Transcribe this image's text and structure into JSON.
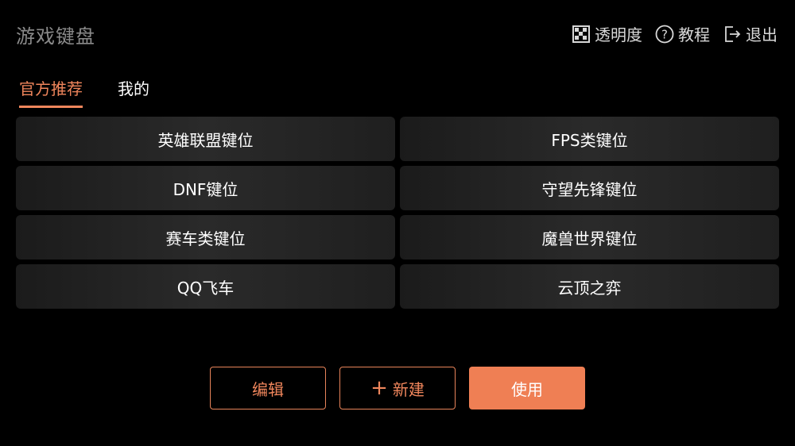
{
  "header": {
    "title": "游戏键盘",
    "actions": [
      {
        "label": "透明度",
        "icon": "transparency-icon"
      },
      {
        "label": "教程",
        "icon": "help-icon"
      },
      {
        "label": "退出",
        "icon": "exit-icon"
      }
    ]
  },
  "tabs": [
    {
      "label": "官方推荐",
      "active": true
    },
    {
      "label": "我的",
      "active": false
    }
  ],
  "layouts": [
    "英雄联盟键位",
    "FPS类键位",
    "DNF键位",
    "守望先锋键位",
    "赛车类键位",
    "魔兽世界键位",
    "QQ飞车",
    "云顶之弈"
  ],
  "footer": {
    "edit_label": "编辑",
    "new_label": "新建",
    "use_label": "使用"
  },
  "colors": {
    "accent": "#EF7F54",
    "background": "#000000",
    "cell": "#242424"
  }
}
